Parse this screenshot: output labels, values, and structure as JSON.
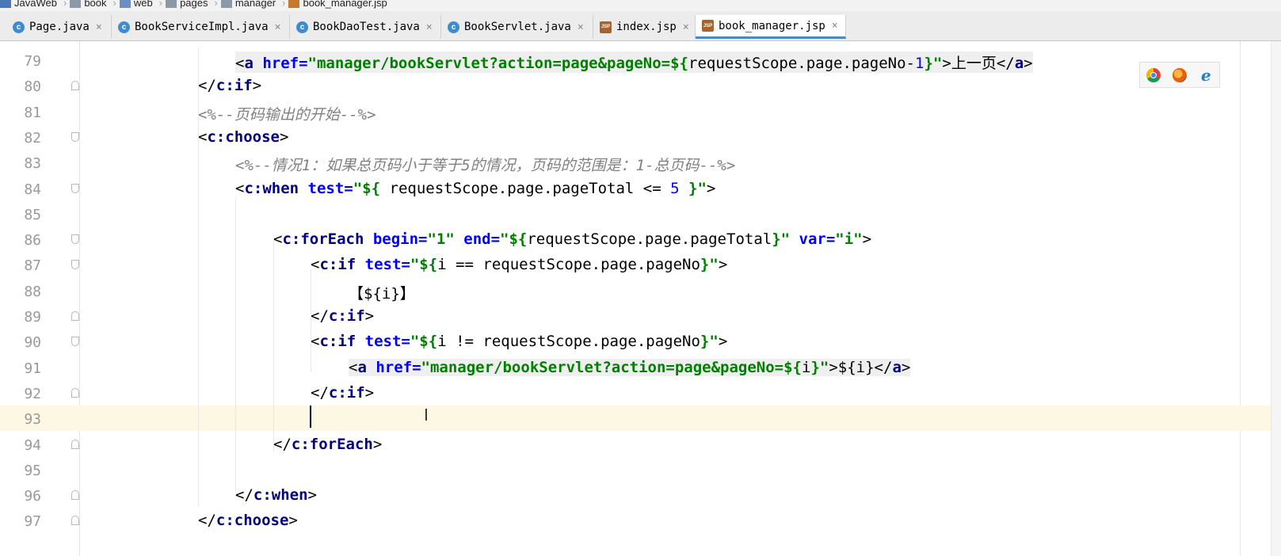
{
  "breadcrumb": [
    {
      "label": "JavaWeb",
      "icon": "project-icon"
    },
    {
      "label": "book",
      "icon": "folder-icon"
    },
    {
      "label": "web",
      "icon": "web-folder-icon"
    },
    {
      "label": "pages",
      "icon": "folder-icon"
    },
    {
      "label": "manager",
      "icon": "folder-icon"
    },
    {
      "label": "book_manager.jsp",
      "icon": "jsp-file-icon"
    }
  ],
  "tabs": [
    {
      "label": "Page.java",
      "icon": "java-class-icon",
      "glyph": "c",
      "active": false
    },
    {
      "label": "BookServiceImpl.java",
      "icon": "java-class-icon",
      "glyph": "c",
      "active": false
    },
    {
      "label": "BookDaoTest.java",
      "icon": "java-class-icon",
      "glyph": "c",
      "active": false
    },
    {
      "label": "BookServlet.java",
      "icon": "java-class-icon",
      "glyph": "c",
      "active": false
    },
    {
      "label": "index.jsp",
      "icon": "jsp-file-icon",
      "glyph": "JSP",
      "active": false
    },
    {
      "label": "book_manager.jsp",
      "icon": "jsp-file-icon",
      "glyph": "JSP",
      "active": true
    }
  ],
  "close_glyph": "×",
  "lines": [
    {
      "num": "79",
      "indent": 2,
      "tokens": [
        {
          "t": "<",
          "c": "el"
        },
        {
          "t": "a ",
          "c": "tag"
        },
        {
          "t": "href=",
          "c": "attr"
        },
        {
          "t": "\"manager/bookServlet?action=page&pageNo=",
          "c": "str"
        },
        {
          "t": "${",
          "c": "str"
        },
        {
          "t": "requestScope.page.pageNo",
          "c": "el"
        },
        {
          "t": "-",
          "c": "el"
        },
        {
          "t": "1",
          "c": "num"
        },
        {
          "t": "}",
          "c": "str"
        },
        {
          "t": "\"",
          "c": "str"
        },
        {
          "t": ">",
          "c": "el"
        },
        {
          "t": "上一页",
          "c": "txt"
        },
        {
          "t": "</",
          "c": "el"
        },
        {
          "t": "a",
          "c": "tag"
        },
        {
          "t": ">",
          "c": "el"
        }
      ],
      "hl": true
    },
    {
      "num": "80",
      "indent": 1,
      "fold": "close",
      "tokens": [
        {
          "t": "</",
          "c": "el"
        },
        {
          "t": "c:if",
          "c": "tag"
        },
        {
          "t": ">",
          "c": "el"
        }
      ]
    },
    {
      "num": "81",
      "indent": 1,
      "tokens": [
        {
          "t": "<%--页码输出的开始--%>",
          "c": "cmt"
        }
      ]
    },
    {
      "num": "82",
      "indent": 1,
      "fold": "open",
      "tokens": [
        {
          "t": "<",
          "c": "el"
        },
        {
          "t": "c:choose",
          "c": "tag"
        },
        {
          "t": ">",
          "c": "el"
        }
      ]
    },
    {
      "num": "83",
      "indent": 2,
      "tokens": [
        {
          "t": "<%--情况1：如果总页码小于等于5的情况，页码的范围是：1-总页码--%>",
          "c": "cmt"
        }
      ]
    },
    {
      "num": "84",
      "indent": 2,
      "fold": "open",
      "tokens": [
        {
          "t": "<",
          "c": "el"
        },
        {
          "t": "c:when ",
          "c": "tag"
        },
        {
          "t": "test=",
          "c": "attr"
        },
        {
          "t": "\"${",
          "c": "str"
        },
        {
          "t": " requestScope.page.pageTotal <= ",
          "c": "el"
        },
        {
          "t": "5",
          "c": "num"
        },
        {
          "t": " }\"",
          "c": "str"
        },
        {
          "t": ">",
          "c": "el"
        }
      ]
    },
    {
      "num": "85",
      "indent": 0,
      "tokens": []
    },
    {
      "num": "86",
      "indent": 3,
      "fold": "open",
      "tokens": [
        {
          "t": "<",
          "c": "el"
        },
        {
          "t": "c:forEach ",
          "c": "tag"
        },
        {
          "t": "begin=",
          "c": "attr"
        },
        {
          "t": "\"1\" ",
          "c": "str"
        },
        {
          "t": "end=",
          "c": "attr"
        },
        {
          "t": "\"${",
          "c": "str"
        },
        {
          "t": "requestScope.page.pageTotal",
          "c": "el"
        },
        {
          "t": "}\" ",
          "c": "str"
        },
        {
          "t": "var=",
          "c": "attr"
        },
        {
          "t": "\"i\"",
          "c": "str"
        },
        {
          "t": ">",
          "c": "el"
        }
      ]
    },
    {
      "num": "87",
      "indent": 4,
      "fold": "open",
      "tokens": [
        {
          "t": "<",
          "c": "el"
        },
        {
          "t": "c:if ",
          "c": "tag"
        },
        {
          "t": "test=",
          "c": "attr"
        },
        {
          "t": "\"${",
          "c": "str"
        },
        {
          "t": "i == requestScope.page.pageNo",
          "c": "el"
        },
        {
          "t": "}\"",
          "c": "str"
        },
        {
          "t": ">",
          "c": "el"
        }
      ]
    },
    {
      "num": "88",
      "indent": 5,
      "tokens": [
        {
          "t": "【${i}】",
          "c": "txt"
        }
      ]
    },
    {
      "num": "89",
      "indent": 4,
      "fold": "close",
      "tokens": [
        {
          "t": "</",
          "c": "el"
        },
        {
          "t": "c:if",
          "c": "tag"
        },
        {
          "t": ">",
          "c": "el"
        }
      ]
    },
    {
      "num": "90",
      "indent": 4,
      "fold": "open",
      "tokens": [
        {
          "t": "<",
          "c": "el"
        },
        {
          "t": "c:if ",
          "c": "tag"
        },
        {
          "t": "test=",
          "c": "attr"
        },
        {
          "t": "\"${",
          "c": "str"
        },
        {
          "t": "i != requestScope.page.pageNo",
          "c": "el"
        },
        {
          "t": "}\"",
          "c": "str"
        },
        {
          "t": ">",
          "c": "el"
        }
      ]
    },
    {
      "num": "91",
      "indent": 5,
      "tokens": [
        {
          "t": "<",
          "c": "el"
        },
        {
          "t": "a ",
          "c": "tag"
        },
        {
          "t": "href=",
          "c": "attr"
        },
        {
          "t": "\"manager/bookServlet?action=page&pageNo=",
          "c": "str"
        },
        {
          "t": "${",
          "c": "str"
        },
        {
          "t": "i",
          "c": "el"
        },
        {
          "t": "}\"",
          "c": "str"
        },
        {
          "t": ">${i}",
          "c": "el"
        },
        {
          "t": "</",
          "c": "el"
        },
        {
          "t": "a",
          "c": "tag"
        },
        {
          "t": ">",
          "c": "el"
        }
      ],
      "hl": true
    },
    {
      "num": "92",
      "indent": 4,
      "fold": "close",
      "tokens": [
        {
          "t": "</",
          "c": "el"
        },
        {
          "t": "c:if",
          "c": "tag"
        },
        {
          "t": ">",
          "c": "el"
        }
      ]
    },
    {
      "num": "93",
      "indent": 0,
      "tokens": [],
      "current": true
    },
    {
      "num": "94",
      "indent": 3,
      "fold": "close",
      "tokens": [
        {
          "t": "</",
          "c": "el"
        },
        {
          "t": "c:forEach",
          "c": "tag"
        },
        {
          "t": ">",
          "c": "el"
        }
      ]
    },
    {
      "num": "95",
      "indent": 0,
      "tokens": []
    },
    {
      "num": "96",
      "indent": 2,
      "fold": "close",
      "tokens": [
        {
          "t": "</",
          "c": "el"
        },
        {
          "t": "c:when",
          "c": "tag"
        },
        {
          "t": ">",
          "c": "el"
        }
      ]
    },
    {
      "num": "97",
      "indent": 1,
      "fold": "close",
      "tokens": [
        {
          "t": "</",
          "c": "el"
        },
        {
          "t": "c:choose",
          "c": "tag"
        },
        {
          "t": ">",
          "c": "el"
        }
      ]
    }
  ],
  "browsers": [
    {
      "name": "chrome-icon"
    },
    {
      "name": "firefox-icon"
    },
    {
      "name": "internet-explorer-icon",
      "glyph": "e"
    }
  ]
}
